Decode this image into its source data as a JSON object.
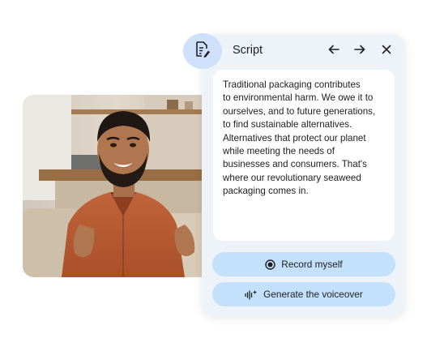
{
  "panel": {
    "title": "Script",
    "icons": {
      "document": "document-edit-icon",
      "back": "arrow-left-icon",
      "forward": "arrow-right-icon",
      "close": "close-icon"
    },
    "script_text": "Traditional packaging contributes\nto environmental harm. We owe it to\nourselves, and to future generations,\nto find sustainable alternatives.\nAlternatives that protect our planet\nwhile meeting the needs of\nbusinesses and consumers. That's\nwhere our revolutionary seaweed\npackaging comes in.",
    "buttons": {
      "record_label": "Record myself",
      "record_icon": "record-icon",
      "voiceover_label": "Generate the voiceover",
      "voiceover_icon": "waveform-sparkle-icon"
    }
  },
  "video": {
    "subject": "presenter-video-thumbnail"
  },
  "colors": {
    "panel_bg": "#eef2f9",
    "button_bg": "#c4e1fb",
    "badge_bg": "#cfe0fb",
    "text": "#202124"
  }
}
